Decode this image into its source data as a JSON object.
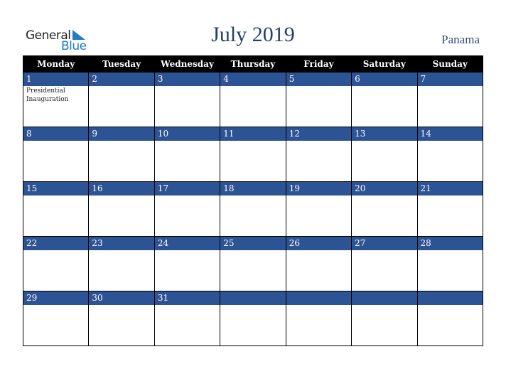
{
  "brand": {
    "line1": "General",
    "line2": "Blue",
    "accent_color": "#1f7dc4"
  },
  "header": {
    "title": "July 2019",
    "country": "Panama",
    "title_color": "#22406e"
  },
  "calendar": {
    "weekdays": [
      "Monday",
      "Tuesday",
      "Wednesday",
      "Thursday",
      "Friday",
      "Saturday",
      "Sunday"
    ],
    "band_color": "#2c5394",
    "weeks": [
      [
        {
          "day": "1",
          "event": "Presidential Inauguration"
        },
        {
          "day": "2",
          "event": ""
        },
        {
          "day": "3",
          "event": ""
        },
        {
          "day": "4",
          "event": ""
        },
        {
          "day": "5",
          "event": ""
        },
        {
          "day": "6",
          "event": ""
        },
        {
          "day": "7",
          "event": ""
        }
      ],
      [
        {
          "day": "8",
          "event": ""
        },
        {
          "day": "9",
          "event": ""
        },
        {
          "day": "10",
          "event": ""
        },
        {
          "day": "11",
          "event": ""
        },
        {
          "day": "12",
          "event": ""
        },
        {
          "day": "13",
          "event": ""
        },
        {
          "day": "14",
          "event": ""
        }
      ],
      [
        {
          "day": "15",
          "event": ""
        },
        {
          "day": "16",
          "event": ""
        },
        {
          "day": "17",
          "event": ""
        },
        {
          "day": "18",
          "event": ""
        },
        {
          "day": "19",
          "event": ""
        },
        {
          "day": "20",
          "event": ""
        },
        {
          "day": "21",
          "event": ""
        }
      ],
      [
        {
          "day": "22",
          "event": ""
        },
        {
          "day": "23",
          "event": ""
        },
        {
          "day": "24",
          "event": ""
        },
        {
          "day": "25",
          "event": ""
        },
        {
          "day": "26",
          "event": ""
        },
        {
          "day": "27",
          "event": ""
        },
        {
          "day": "28",
          "event": ""
        }
      ],
      [
        {
          "day": "29",
          "event": ""
        },
        {
          "day": "30",
          "event": ""
        },
        {
          "day": "31",
          "event": ""
        },
        {
          "day": "",
          "event": ""
        },
        {
          "day": "",
          "event": ""
        },
        {
          "day": "",
          "event": ""
        },
        {
          "day": "",
          "event": ""
        }
      ]
    ]
  }
}
